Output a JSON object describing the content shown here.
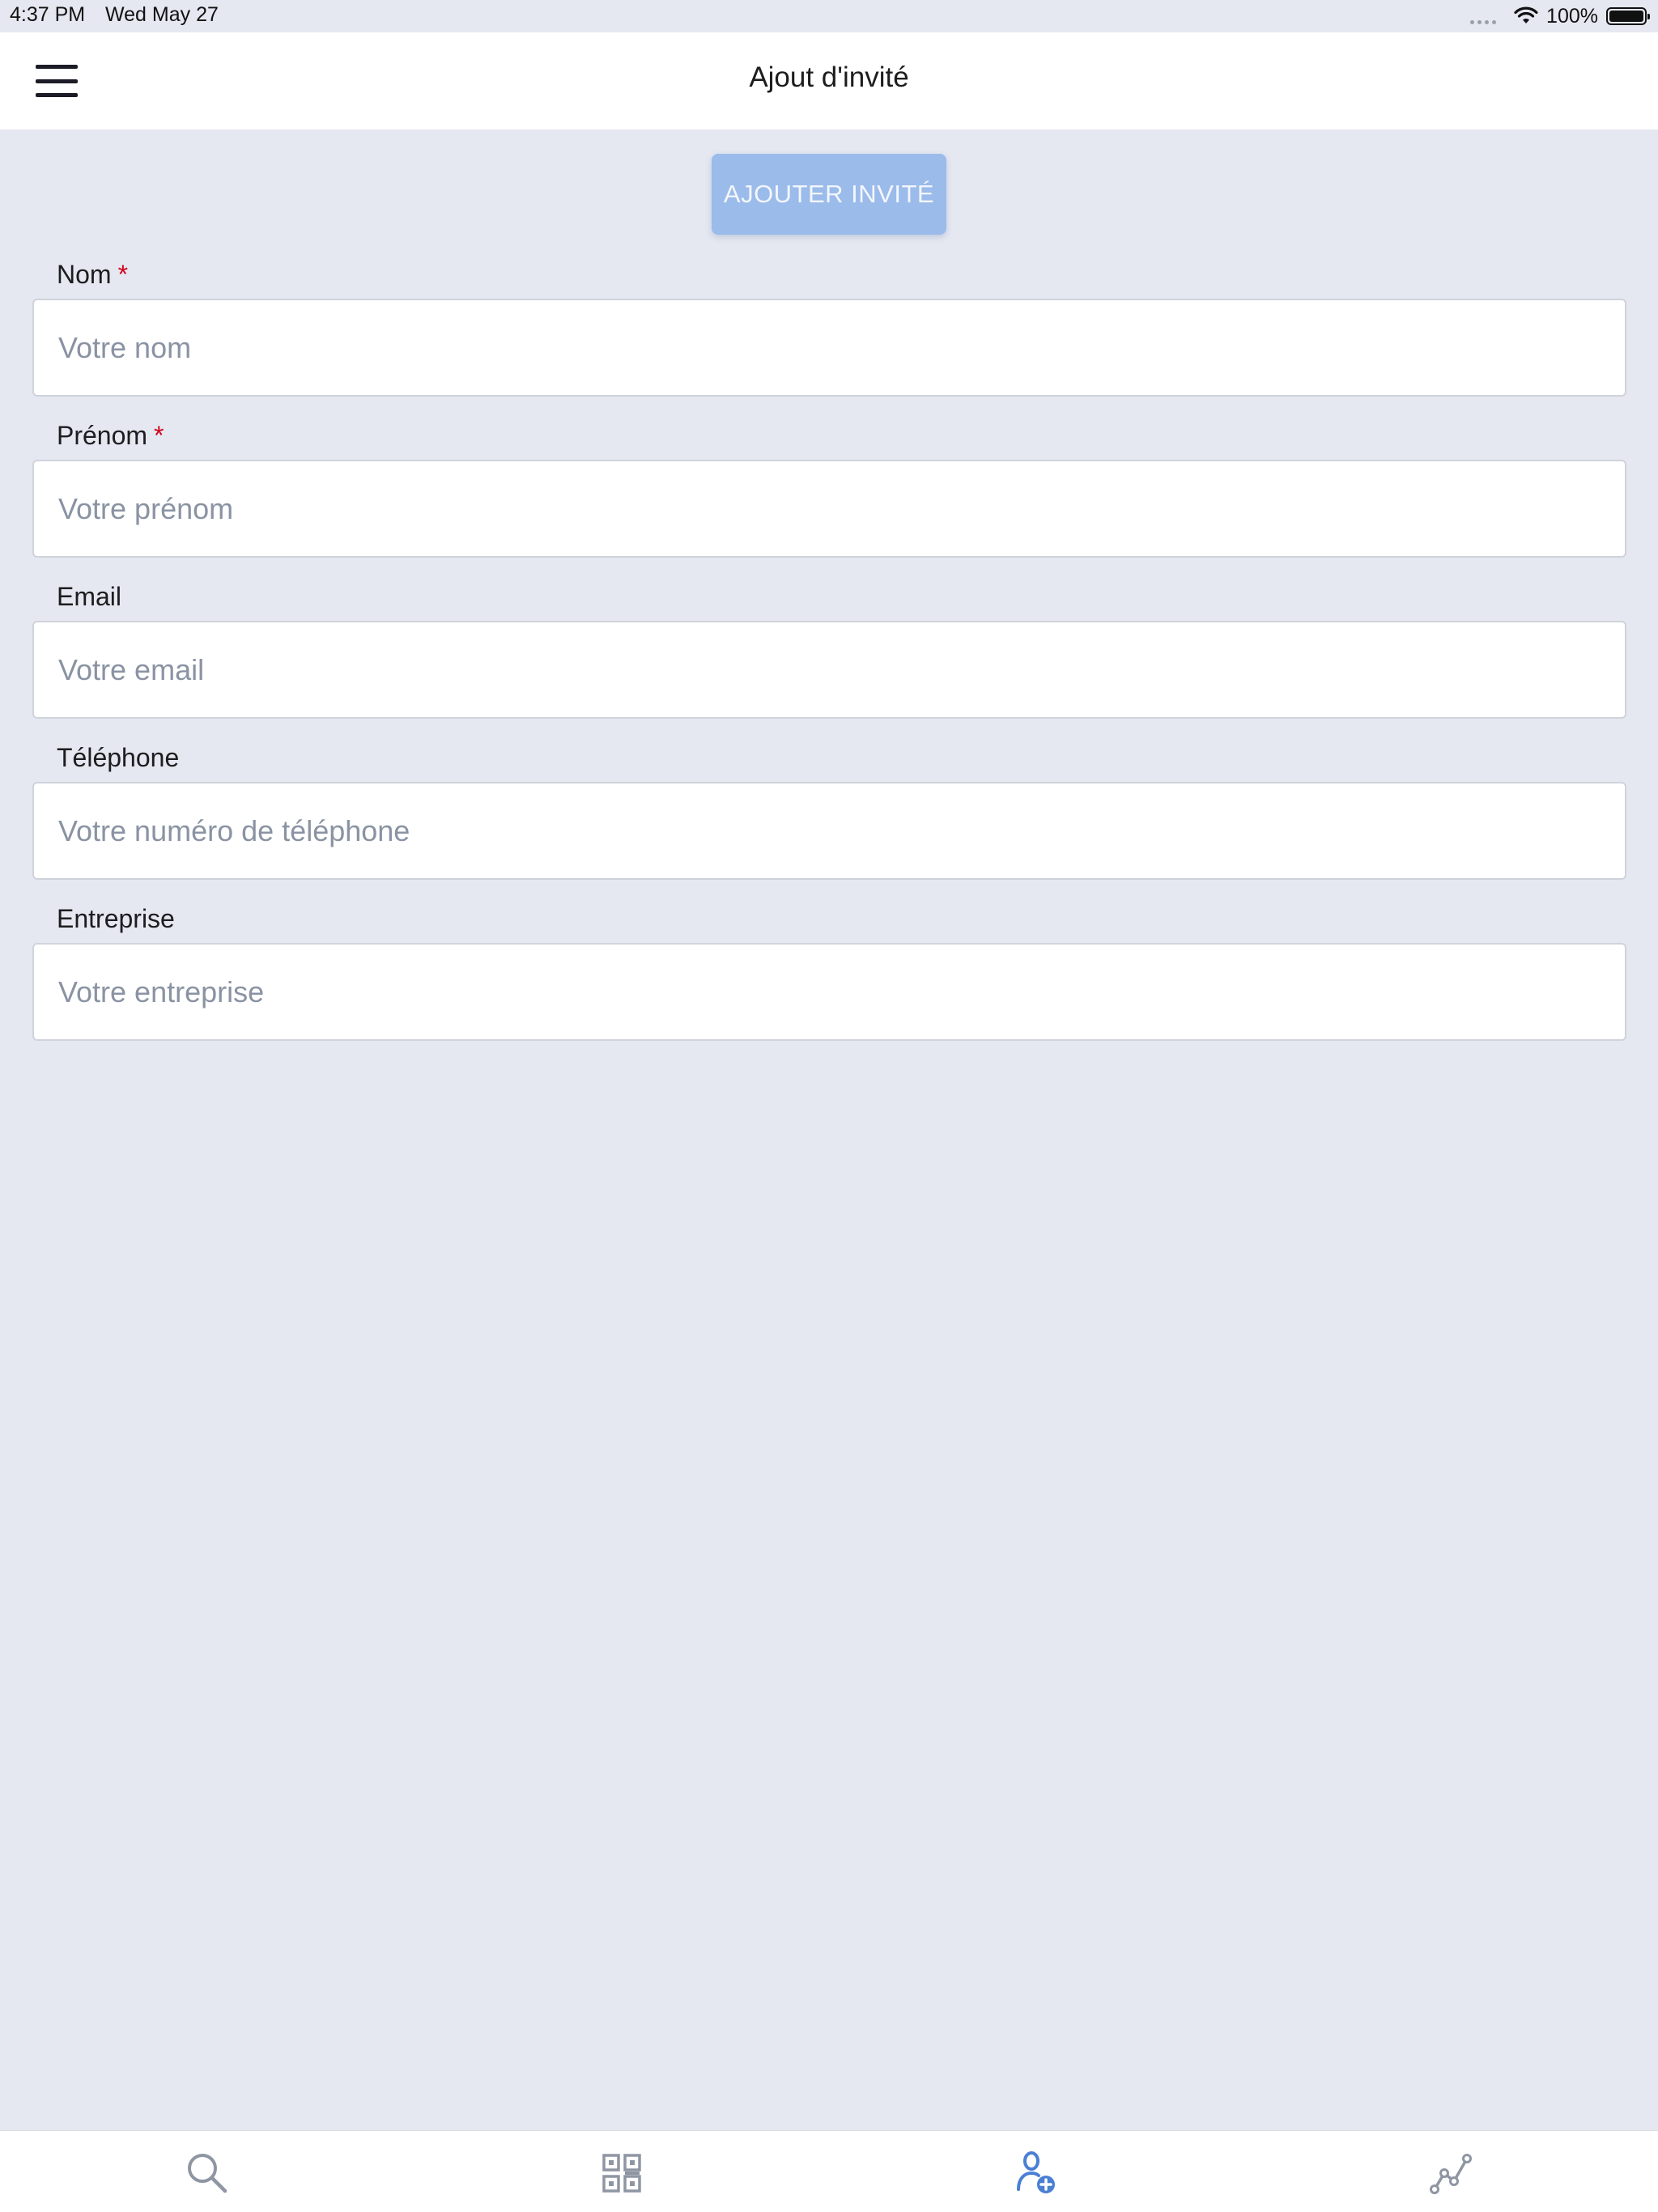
{
  "status_bar": {
    "time": "4:37 PM",
    "date": "Wed May 27",
    "battery": "100%"
  },
  "header": {
    "title": "Ajout d'invité",
    "menu_icon": "hamburger-menu-icon"
  },
  "actions": {
    "add_guest_label": "AJOUTER INVITÉ"
  },
  "form": {
    "fields": [
      {
        "label": "Nom",
        "required": "*",
        "placeholder": "Votre nom",
        "value": ""
      },
      {
        "label": "Prénom",
        "required": "*",
        "placeholder": "Votre prénom",
        "value": ""
      },
      {
        "label": "Email",
        "placeholder": "Votre email",
        "value": ""
      },
      {
        "label": "Téléphone",
        "placeholder": "Votre numéro de téléphone",
        "value": ""
      },
      {
        "label": "Entreprise",
        "placeholder": "Votre entreprise",
        "value": ""
      }
    ]
  },
  "tab_bar": {
    "tabs": [
      {
        "icon": "search-icon",
        "active": false
      },
      {
        "icon": "qr-code-icon",
        "active": false
      },
      {
        "icon": "add-user-icon",
        "active": true
      },
      {
        "icon": "stats-chart-icon",
        "active": false
      }
    ]
  },
  "colors": {
    "background": "#e5e8f1",
    "button": "#9bbbea",
    "required": "#d0021b",
    "tab_active": "#4a7fd4",
    "tab_inactive": "#8f96a3"
  }
}
